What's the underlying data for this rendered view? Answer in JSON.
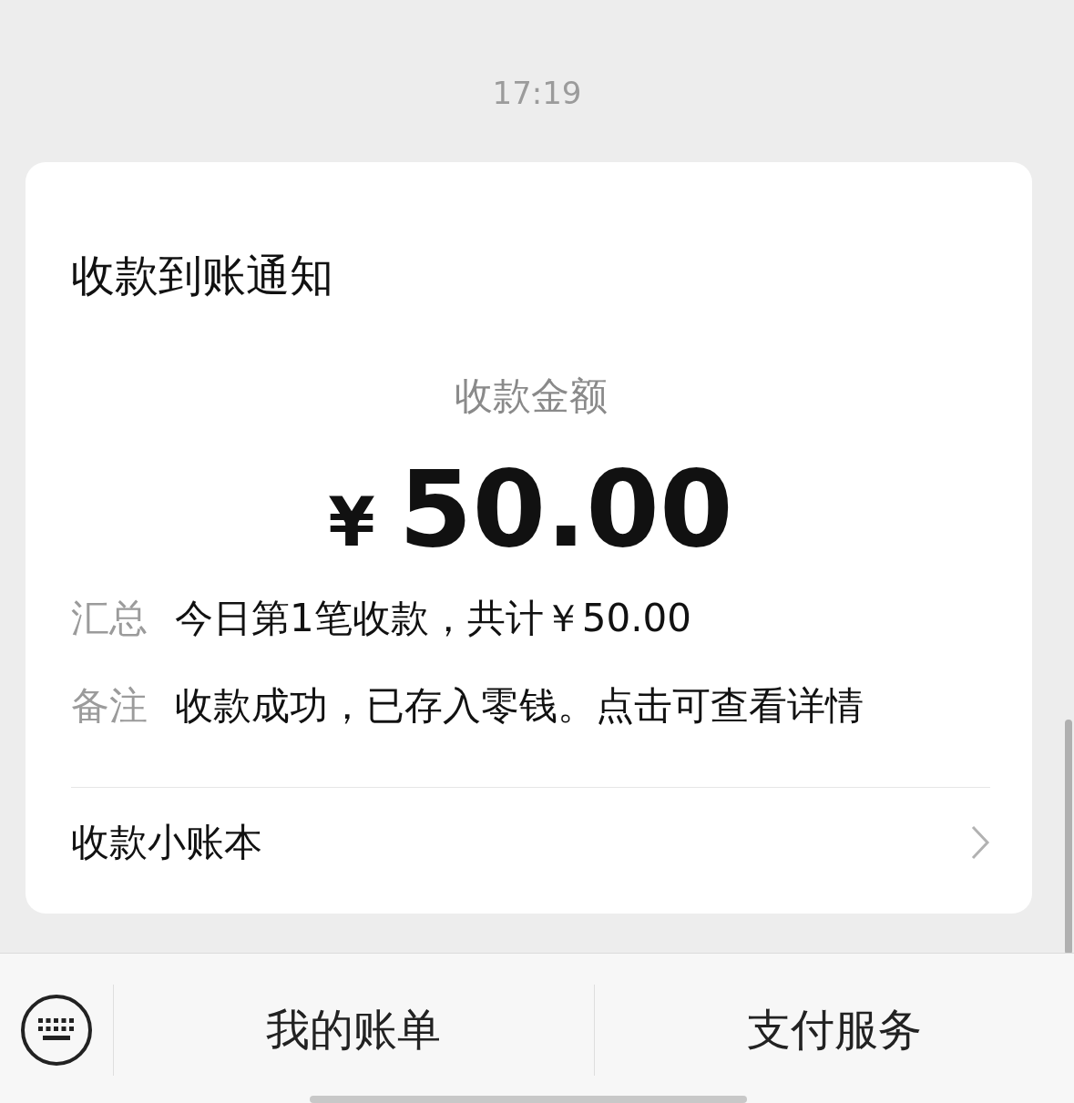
{
  "time": "17:19",
  "card": {
    "title": "收款到账通知",
    "amount_label": "收款金额",
    "currency": "¥",
    "amount": "50.00",
    "rows": [
      {
        "label": "汇总",
        "value": "今日第1笔收款，共计￥50.00"
      },
      {
        "label": "备注",
        "value": "收款成功，已存入零钱。点击可查看详情"
      }
    ],
    "footer_link": "收款小账本"
  },
  "bottom_bar": {
    "buttons": [
      "我的账单",
      "支付服务"
    ]
  }
}
